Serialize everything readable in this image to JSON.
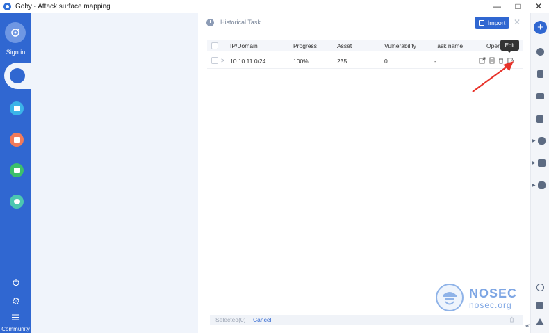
{
  "window": {
    "title": "Goby - Attack surface mapping",
    "controls": [
      "—",
      "□",
      "✕"
    ]
  },
  "sidebar": {
    "sign_in_label": "Sign in",
    "community_label": "Community",
    "colors": {
      "background": "#3067d1",
      "item1": "#3cb4e8",
      "item2": "#f07a5a",
      "item3": "#3cbf6a",
      "item4": "#4cc7b0"
    }
  },
  "panel": {
    "title": "Historical Task",
    "import_label": "Import",
    "columns": [
      "IP/Domain",
      "Progress",
      "Asset",
      "Vulnerability",
      "Task name",
      "Operation"
    ],
    "rows": [
      {
        "ip": "10.10.11.0/24",
        "progress": "100%",
        "asset": "235",
        "vulnerability": "0",
        "task_name": "-"
      }
    ],
    "tooltip": "Edit",
    "footer": {
      "selected": "Selected(0)",
      "cancel": "Cancel"
    }
  },
  "watermark": {
    "name": "NOSEC",
    "url": "nosec.org"
  },
  "colors": {
    "accent": "#3067d1",
    "arrow": "#e8332a"
  }
}
